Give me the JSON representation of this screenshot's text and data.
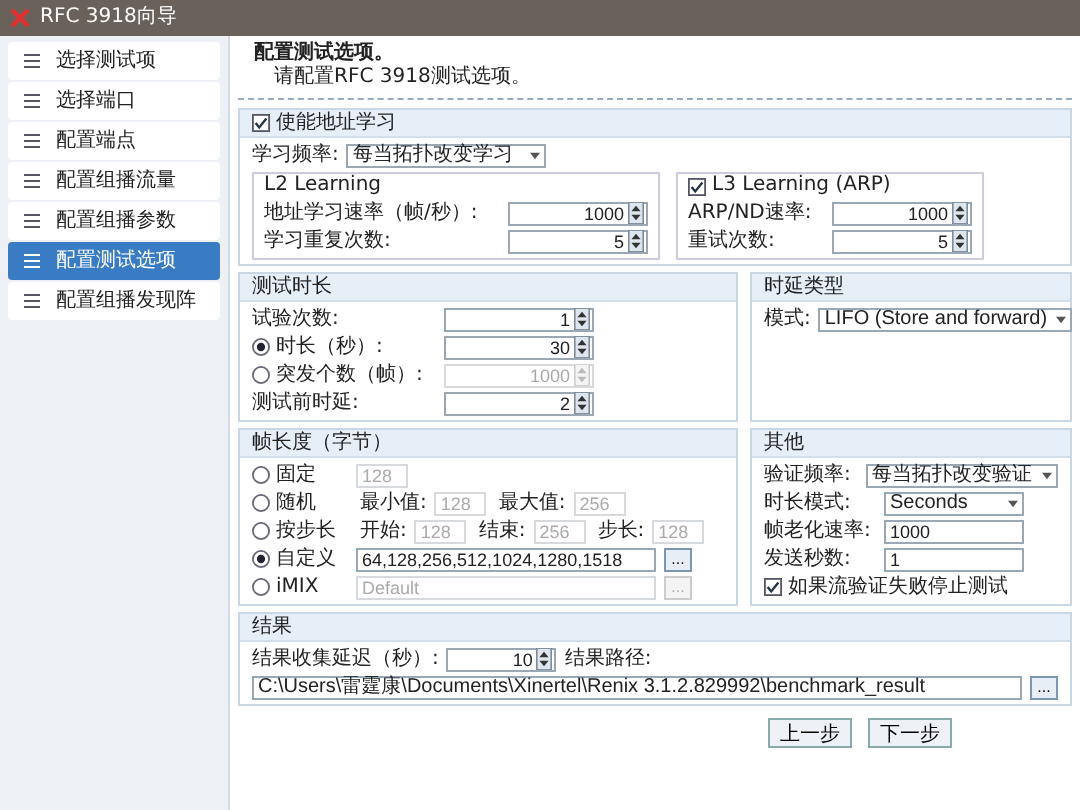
{
  "window": {
    "title": "RFC 3918向导"
  },
  "sidebar": {
    "items": [
      {
        "label": "选择测试项",
        "selected": false
      },
      {
        "label": "选择端口",
        "selected": false
      },
      {
        "label": "配置端点",
        "selected": false
      },
      {
        "label": "配置组播流量",
        "selected": false
      },
      {
        "label": "配置组播参数",
        "selected": false
      },
      {
        "label": "配置测试选项",
        "selected": true
      },
      {
        "label": "配置组播发现阵",
        "selected": false
      }
    ]
  },
  "header": {
    "title": "配置测试选项。",
    "subtitle": "请配置RFC 3918测试选项。"
  },
  "learning": {
    "enable": {
      "label": "使能地址学习",
      "checked": true
    },
    "frequency": {
      "label": "学习频率:",
      "value": "每当拓扑改变学习"
    },
    "l2": {
      "title": "L2 Learning",
      "fields": [
        {
          "label": "地址学习速率（帧/秒）:",
          "value": "1000"
        },
        {
          "label": "学习重复次数:",
          "value": "5"
        }
      ]
    },
    "l3": {
      "title": "L3 Learning (ARP)",
      "checked": true,
      "fields": [
        {
          "label": "ARP/ND速率:",
          "value": "1000"
        },
        {
          "label": "重试次数:",
          "value": "5"
        }
      ]
    }
  },
  "duration": {
    "title": "测试时长",
    "rows": [
      {
        "kind": "spin",
        "label": "试验次数:",
        "value": "1"
      },
      {
        "kind": "radio",
        "label": "时长（秒）:",
        "value": "30",
        "selected": true
      },
      {
        "kind": "radio",
        "label": "突发个数（帧）:",
        "value": "1000",
        "selected": false
      },
      {
        "kind": "spin",
        "label": "测试前时延:",
        "value": "2"
      }
    ]
  },
  "latency": {
    "title": "时延类型",
    "label": "模式:",
    "value": "LIFO (Store and forward)"
  },
  "frame_size": {
    "title": "帧长度（字节）",
    "options": [
      {
        "label": "固定",
        "selected": false,
        "fields": [
          {
            "value": "128"
          }
        ]
      },
      {
        "label": "随机",
        "selected": false,
        "fields": [
          {
            "label": "最小值:",
            "value": "128"
          },
          {
            "label": "最大值:",
            "value": "256"
          }
        ]
      },
      {
        "label": "按步长",
        "selected": false,
        "fields": [
          {
            "label": "开始:",
            "value": "128"
          },
          {
            "label": "结束:",
            "value": "256"
          },
          {
            "label": "步长:",
            "value": "128"
          }
        ]
      },
      {
        "label": "自定义",
        "selected": true,
        "fields": [
          {
            "value": "64,128,256,512,1024,1280,1518"
          }
        ],
        "browse": "..."
      },
      {
        "label": "iMIX",
        "selected": false,
        "fields": [
          {
            "value": "Default"
          }
        ],
        "browse": "..."
      }
    ]
  },
  "other": {
    "title": "其他",
    "rows": [
      {
        "kind": "select",
        "label": "验证频率:",
        "value": "每当拓扑改变验证"
      },
      {
        "kind": "select",
        "label": "时长模式:",
        "value": "Seconds"
      },
      {
        "kind": "text",
        "label": "帧老化速率:",
        "value": "1000"
      },
      {
        "kind": "text",
        "label": "发送秒数:",
        "value": "1"
      },
      {
        "kind": "checkbox",
        "label": "如果流验证失败停止测试",
        "checked": true
      }
    ]
  },
  "results": {
    "title": "结果",
    "delay": {
      "label": "结果收集延迟（秒）:",
      "value": "10"
    },
    "path": {
      "label": "结果路径:",
      "value": "C:\\Users\\雷霆康\\Documents\\Xinertel\\Renix 3.1.2.829992\\benchmark_result",
      "browse": "..."
    }
  },
  "buttons": [
    "上一步",
    "下一步"
  ]
}
